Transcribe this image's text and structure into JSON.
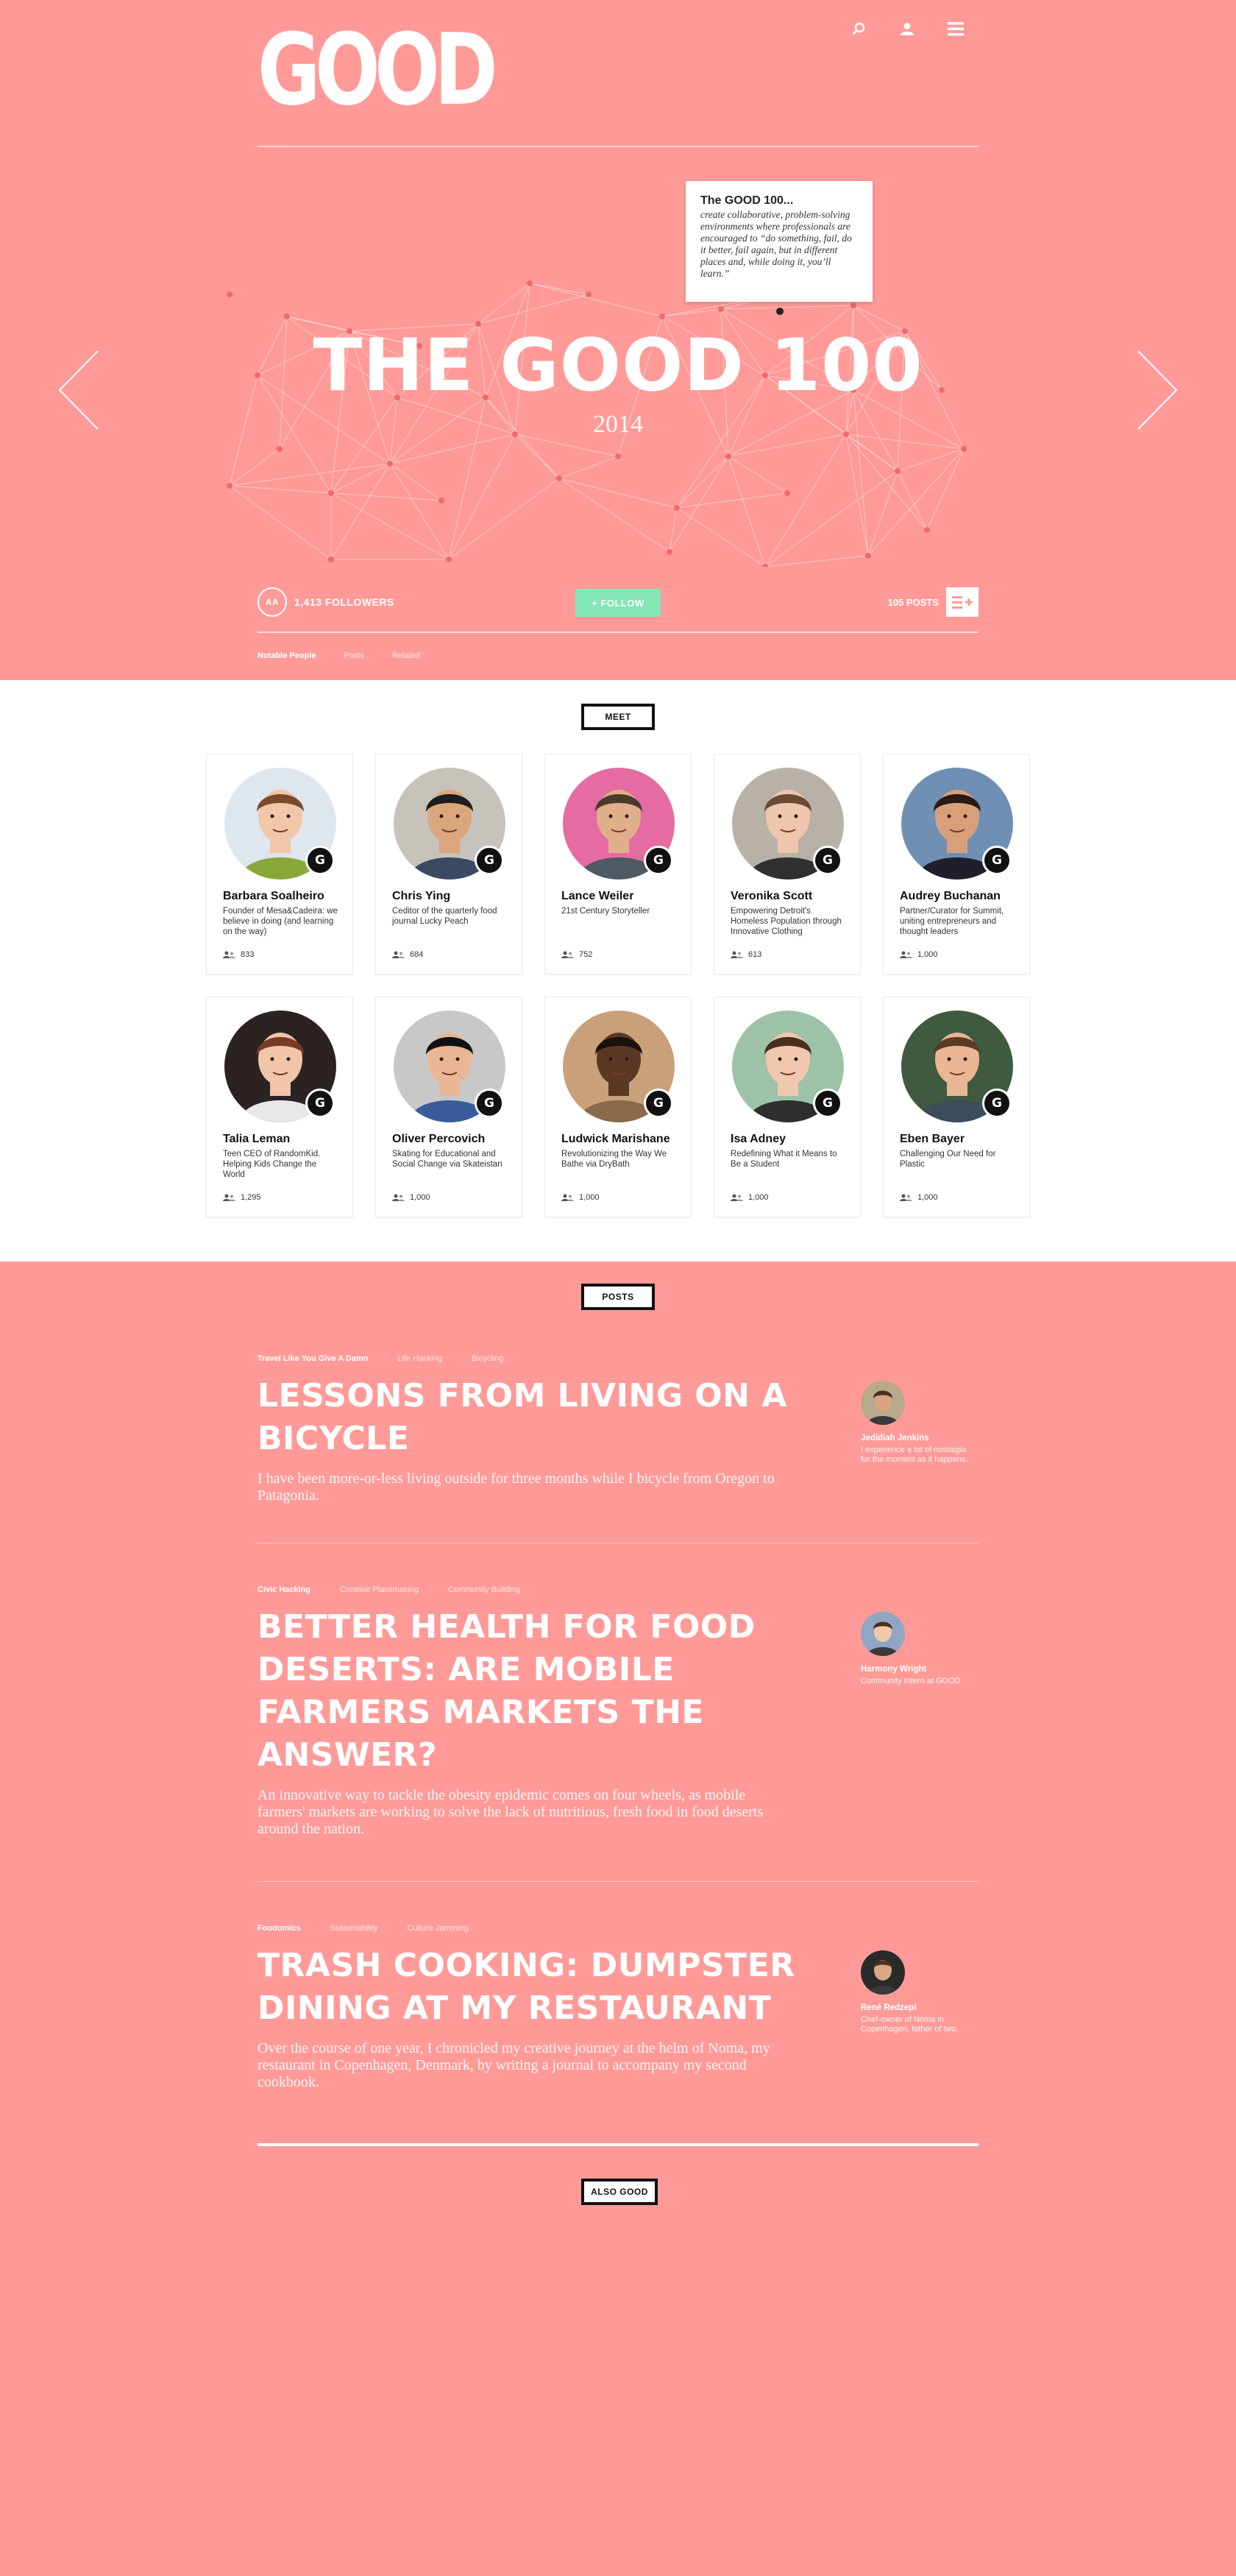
{
  "header": {
    "logo": "GOOD",
    "icons": [
      "search-icon",
      "user-icon",
      "menu-icon"
    ]
  },
  "hero": {
    "title": "THE GOOD 100",
    "year": "2014",
    "tooltip": {
      "title": "The GOOD 100...",
      "text": "create collaborative, problem-solving environments where professionals are encouraged to “do something, fail, do it better, fail again, but in different places and, while doing it, you’ll learn.”"
    },
    "followers_icon": "AA",
    "followers": "1,413 FOLLOWERS",
    "follow_button": "+ FOLLOW",
    "posts_count": "105 POSTS",
    "tabs": [
      "Notable People",
      "Posts",
      "Related"
    ]
  },
  "meet": {
    "label": "MEET",
    "people": [
      {
        "name": "Barbara Soalheiro",
        "desc": "Founder of Mesa&Cadeira: we believe in doing (and learning on the way)",
        "count": "833",
        "skin": "#f0c7a8",
        "hair": "#7a4b2a",
        "bg": "#dfe6ee",
        "shirt": "#8aa83a"
      },
      {
        "name": "Chris Ying",
        "desc": "Ceditor of the quarterly food journal Lucky Peach",
        "count": "684",
        "skin": "#d9a67e",
        "hair": "#1d1d1d",
        "bg": "#c7c2bb",
        "shirt": "#3b4a63"
      },
      {
        "name": "Lance Weiler",
        "desc": "21st Century Storyteller",
        "count": "752",
        "skin": "#e1ae8c",
        "hair": "#4b3a2c",
        "bg": "#e46ca2",
        "shirt": "#4e5a66"
      },
      {
        "name": "Veronika Scott",
        "desc": "Empowering Detroit's Homeless Population through Innovative Clothing",
        "count": "613",
        "skin": "#efc5ad",
        "hair": "#6a4a35",
        "bg": "#b7b1a8",
        "shirt": "#2f2f2f"
      },
      {
        "name": "Audrey Buchanan",
        "desc": "Partner/Curator for Summit, uniting entrepreneurs and thought leaders",
        "count": "1,000",
        "skin": "#d7a07b",
        "hair": "#2a1a12",
        "bg": "#6f8fb5",
        "shirt": "#1f1f2b"
      },
      {
        "name": "Talia Leman",
        "desc": "Teen CEO of RandomKid. Helping Kids Change the World",
        "count": "1,295",
        "skin": "#f2c4a8",
        "hair": "#7a3b23",
        "bg": "#2b2222",
        "shirt": "#e8e8e8"
      },
      {
        "name": "Oliver Percovich",
        "desc": "Skating for Educational and Social Change via Skateistan",
        "count": "1,000",
        "skin": "#e9b796",
        "hair": "#111111",
        "bg": "#c8c8c8",
        "shirt": "#3a5b9a"
      },
      {
        "name": "Ludwick Marishane",
        "desc": "Revolutionizing the Way We Bathe via DryBath",
        "count": "1,000",
        "skin": "#5a3824",
        "hair": "#1b120c",
        "bg": "#caa07a",
        "shirt": "#8a6a4a"
      },
      {
        "name": "Isa Adney",
        "desc": "Redefining What it Means to Be a Student",
        "count": "1,000",
        "skin": "#f1c8ae",
        "hair": "#4a2e1f",
        "bg": "#9ec2a7",
        "shirt": "#2e2e2e"
      },
      {
        "name": "Eben Bayer",
        "desc": "Challenging Our Need for Plastic",
        "count": "1,000",
        "skin": "#e9b696",
        "hair": "#5b3b26",
        "bg": "#3f5a3f",
        "shirt": "#3b4c5c"
      }
    ]
  },
  "posts": {
    "label": "POSTS",
    "items": [
      {
        "tags": [
          "Travel Like You Give A Damn",
          "Life Hacking",
          "Bicycling"
        ],
        "title": "LESSONS FROM LIVING ON A BICYCLE",
        "desc": "I have been more-or-less living outside for three months while I bicycle from Oregon to Patagonia.",
        "author": {
          "name": "Jedidiah Jenkins",
          "desc": "I experience a lot of nostalgia for the moment as it happens.",
          "skin": "#d7a57f",
          "bg": "#b9a98c"
        }
      },
      {
        "tags": [
          "Civic Hacking",
          "Creative Placemaking",
          "Community Building"
        ],
        "title": "BETTER HEALTH FOR FOOD DESERTS: ARE MOBILE FARMERS MARKETS THE ANSWER?",
        "desc": "An innovative way to tackle the obesity epidemic comes on four wheels, as mobile farmers' markets are working to solve the lack of nutritious, fresh food in food deserts around the nation.",
        "author": {
          "name": "Harmony Wright",
          "desc": "Community Intern at GOOD",
          "skin": "#f0c9ad",
          "bg": "#8fa7c4"
        }
      },
      {
        "tags": [
          "Foodomics",
          "Sustainability",
          "Culture Jamming"
        ],
        "title": "TRASH COOKING: DUMPSTER DINING AT MY RESTAURANT",
        "desc": "Over the course of one year, I chronicled my creative journey at the helm of Noma, my restaurant in Copenhagen, Denmark, by writing a journal to accompany my second cookbook.",
        "author": {
          "name": "René Redzepi",
          "desc": "Chef-owner of Noma in Copenhagen, father of two.",
          "skin": "#d9a786",
          "bg": "#2a2a2a"
        }
      }
    ]
  },
  "also": {
    "label": "ALSO GOOD"
  },
  "colors": {
    "background": "#ff9a98",
    "accent": "#83e6b5",
    "white": "#ffffff"
  }
}
